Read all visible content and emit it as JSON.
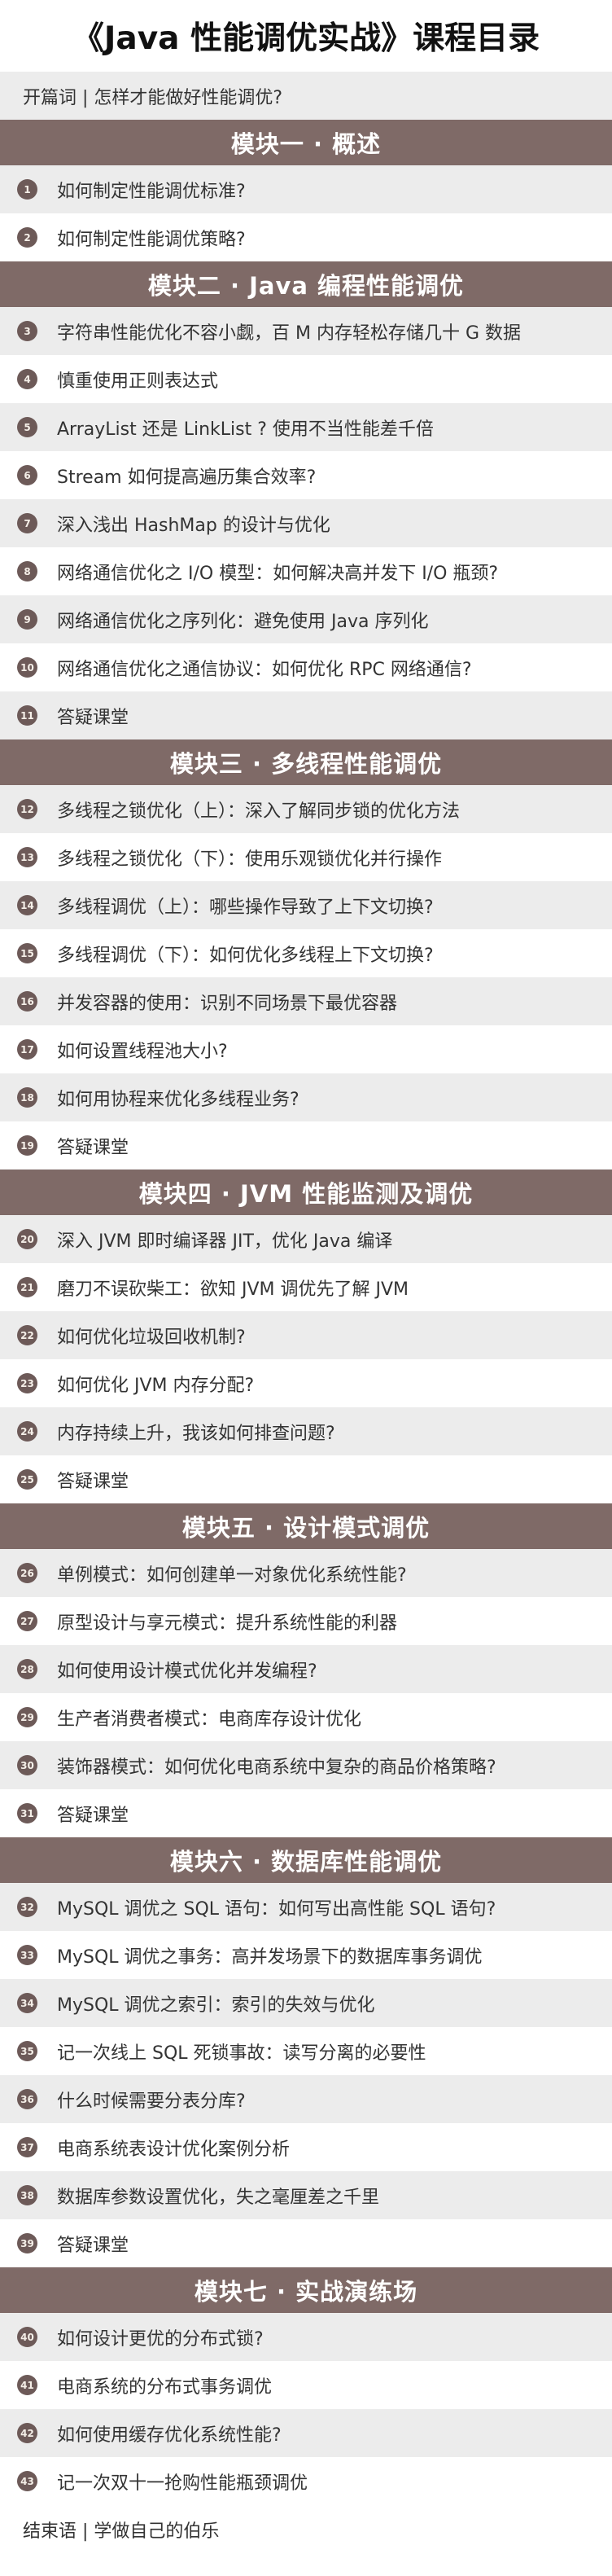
{
  "title": "《Java 性能调优实战》课程目录",
  "preface": "开篇词 | 怎样才能做好性能调优?",
  "modules": [
    {
      "name": "模块一 · 概述",
      "lessons": [
        {
          "num": "1",
          "text": "如何制定性能调优标准?"
        },
        {
          "num": "2",
          "text": "如何制定性能调优策略?"
        }
      ]
    },
    {
      "name": "模块二 · Java 编程性能调优",
      "lessons": [
        {
          "num": "3",
          "text": "字符串性能优化不容小觑，百 M 内存轻松存储几十 G 数据"
        },
        {
          "num": "4",
          "text": "慎重使用正则表达式"
        },
        {
          "num": "5",
          "text": "ArrayList 还是 LinkList ? 使用不当性能差千倍"
        },
        {
          "num": "6",
          "text": "Stream 如何提高遍历集合效率?"
        },
        {
          "num": "7",
          "text": "深入浅出 HashMap 的设计与优化"
        },
        {
          "num": "8",
          "text": "网络通信优化之 I/O 模型：如何解决高并发下 I/O 瓶颈?"
        },
        {
          "num": "9",
          "text": "网络通信优化之序列化：避免使用 Java 序列化"
        },
        {
          "num": "10",
          "text": "网络通信优化之通信协议：如何优化 RPC 网络通信?"
        },
        {
          "num": "11",
          "text": "答疑课堂"
        }
      ]
    },
    {
      "name": "模块三 · 多线程性能调优",
      "lessons": [
        {
          "num": "12",
          "text": "多线程之锁优化（上）：深入了解同步锁的优化方法"
        },
        {
          "num": "13",
          "text": "多线程之锁优化（下）：使用乐观锁优化并行操作"
        },
        {
          "num": "14",
          "text": "多线程调优（上）：哪些操作导致了上下文切换?"
        },
        {
          "num": "15",
          "text": "多线程调优（下）：如何优化多线程上下文切换?"
        },
        {
          "num": "16",
          "text": "并发容器的使用：识别不同场景下最优容器"
        },
        {
          "num": "17",
          "text": "如何设置线程池大小?"
        },
        {
          "num": "18",
          "text": "如何用协程来优化多线程业务?"
        },
        {
          "num": "19",
          "text": "答疑课堂"
        }
      ]
    },
    {
      "name": "模块四 · JVM 性能监测及调优",
      "lessons": [
        {
          "num": "20",
          "text": "深入 JVM 即时编译器 JIT，优化 Java 编译"
        },
        {
          "num": "21",
          "text": "磨刀不误砍柴工：欲知 JVM 调优先了解 JVM"
        },
        {
          "num": "22",
          "text": "如何优化垃圾回收机制?"
        },
        {
          "num": "23",
          "text": "如何优化 JVM 内存分配?"
        },
        {
          "num": "24",
          "text": "内存持续上升，我该如何排查问题?"
        },
        {
          "num": "25",
          "text": "答疑课堂"
        }
      ]
    },
    {
      "name": "模块五 · 设计模式调优",
      "lessons": [
        {
          "num": "26",
          "text": "单例模式：如何创建单一对象优化系统性能?"
        },
        {
          "num": "27",
          "text": "原型设计与享元模式：提升系统性能的利器"
        },
        {
          "num": "28",
          "text": "如何使用设计模式优化并发编程?"
        },
        {
          "num": "29",
          "text": "生产者消费者模式：电商库存设计优化"
        },
        {
          "num": "30",
          "text": "装饰器模式：如何优化电商系统中复杂的商品价格策略?"
        },
        {
          "num": "31",
          "text": "答疑课堂"
        }
      ]
    },
    {
      "name": "模块六 · 数据库性能调优",
      "lessons": [
        {
          "num": "32",
          "text": "MySQL 调优之 SQL 语句：如何写出高性能 SQL 语句?"
        },
        {
          "num": "33",
          "text": "MySQL 调优之事务：高并发场景下的数据库事务调优"
        },
        {
          "num": "34",
          "text": "MySQL 调优之索引：索引的失效与优化"
        },
        {
          "num": "35",
          "text": "记一次线上 SQL 死锁事故：读写分离的必要性"
        },
        {
          "num": "36",
          "text": "什么时候需要分表分库?"
        },
        {
          "num": "37",
          "text": "电商系统表设计优化案例分析"
        },
        {
          "num": "38",
          "text": "数据库参数设置优化，失之毫厘差之千里"
        },
        {
          "num": "39",
          "text": "答疑课堂"
        }
      ]
    },
    {
      "name": "模块七 · 实战演练场",
      "lessons": [
        {
          "num": "40",
          "text": "如何设计更优的分布式锁?"
        },
        {
          "num": "41",
          "text": "电商系统的分布式事务调优"
        },
        {
          "num": "42",
          "text": "如何使用缓存优化系统性能?"
        },
        {
          "num": "43",
          "text": "记一次双十一抢购性能瓶颈调优"
        }
      ]
    }
  ],
  "epilogue": "结束语 | 学做自己的伯乐"
}
